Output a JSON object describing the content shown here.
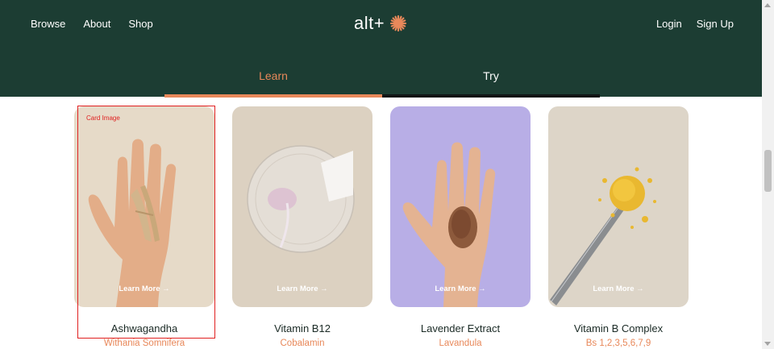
{
  "header": {
    "nav_left": [
      "Browse",
      "About",
      "Shop"
    ],
    "logo_text": "alt+",
    "nav_right": [
      "Login",
      "Sign Up"
    ],
    "tabs": [
      {
        "label": "Learn",
        "active": true
      },
      {
        "label": "Try",
        "active": false
      }
    ]
  },
  "cards": [
    {
      "title": "Ashwagandha",
      "subtitle": "Withania Somnifera",
      "cta": "Learn More →",
      "image_bg": "#e6dac8"
    },
    {
      "title": "Vitamin B12",
      "subtitle": "Cobalamin",
      "cta": "Learn More →",
      "image_bg": "#dcd1c1"
    },
    {
      "title": "Lavender Extract",
      "subtitle": "Lavandula",
      "cta": "Learn More →",
      "image_bg": "#b8aee6"
    },
    {
      "title": "Vitamin B Complex",
      "subtitle": "Bs 1,2,3,5,6,7,9",
      "cta": "Learn More →",
      "image_bg": "#ddd5c8"
    }
  ],
  "annotation": {
    "label": "Card Image"
  },
  "colors": {
    "header_bg": "#1c3d33",
    "accent": "#e8885a",
    "annotation": "#e02020"
  }
}
